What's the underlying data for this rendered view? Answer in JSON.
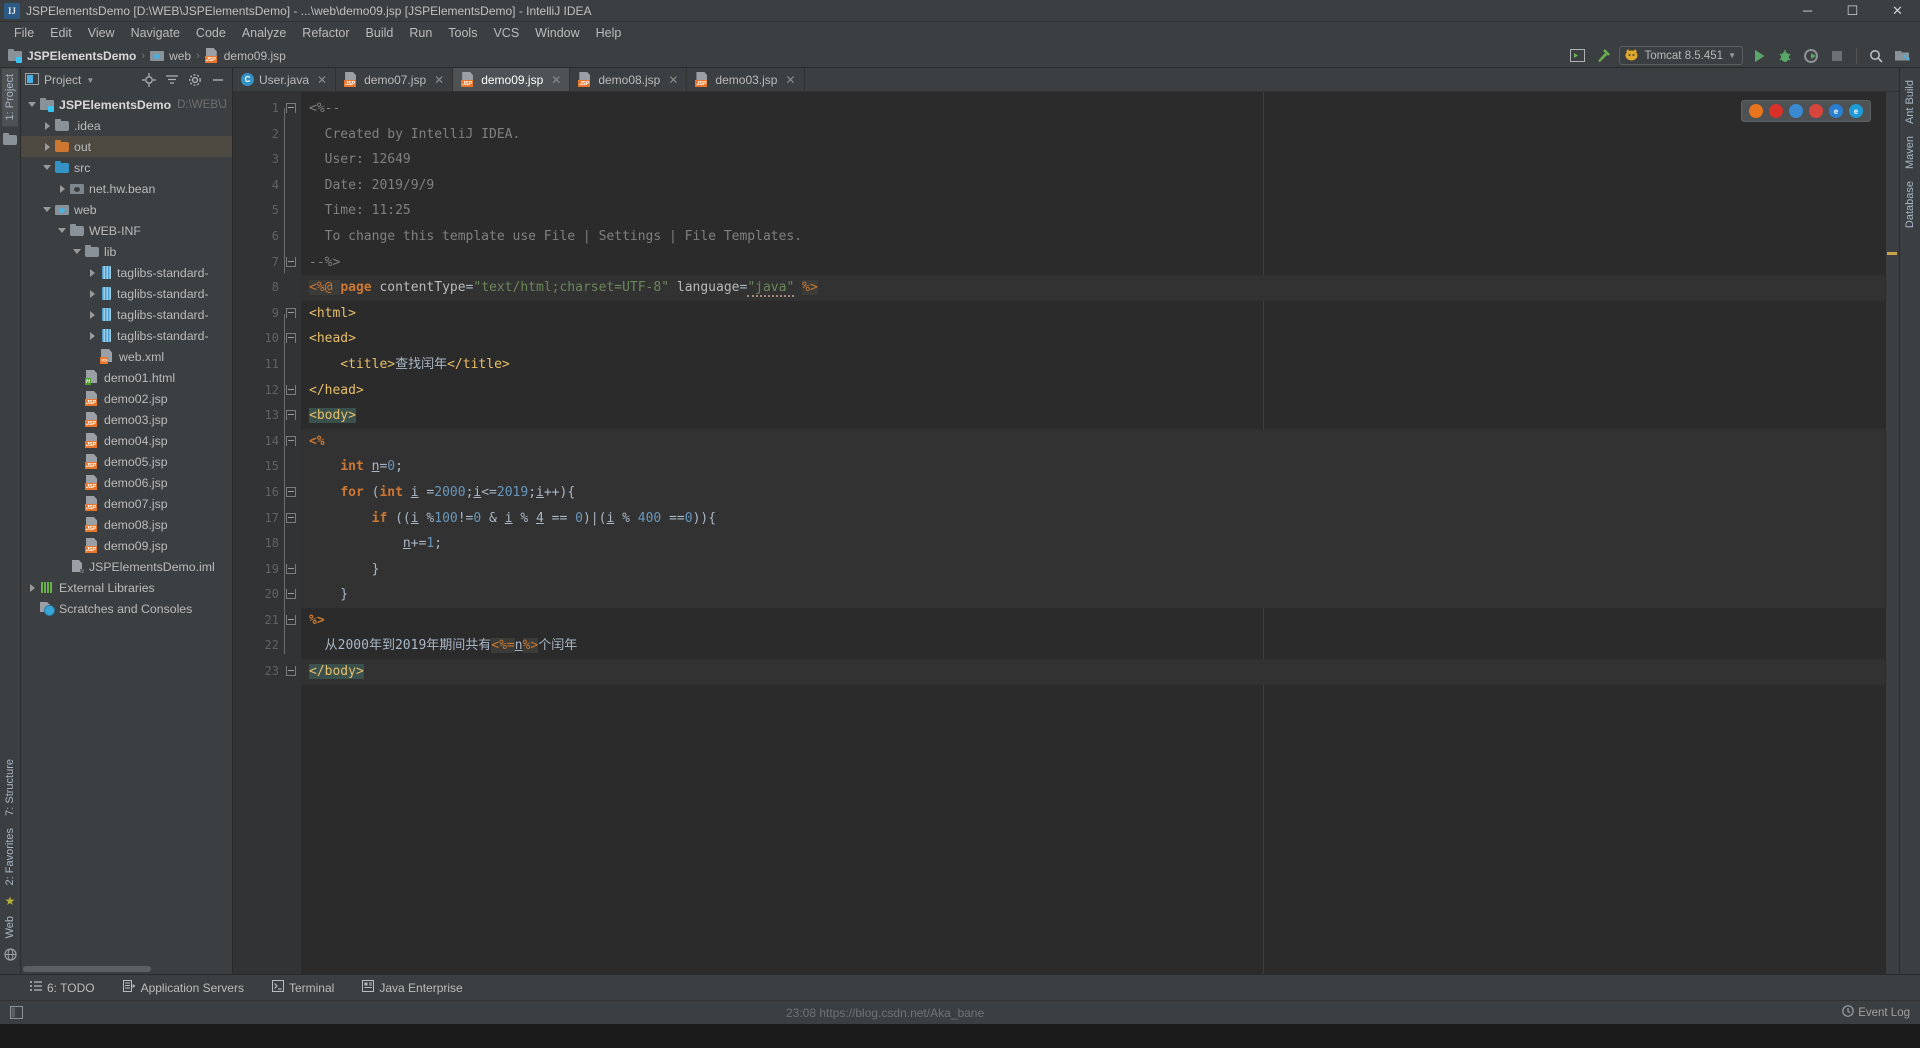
{
  "window": {
    "title": "JSPElementsDemo [D:\\WEB\\JSPElementsDemo] - ...\\web\\demo09.jsp [JSPElementsDemo] - IntelliJ IDEA",
    "app_badge": "IJ",
    "minimize": "─",
    "maximize": "☐",
    "close": "✕"
  },
  "menubar": {
    "items": [
      {
        "label": "File"
      },
      {
        "label": "Edit"
      },
      {
        "label": "View"
      },
      {
        "label": "Navigate"
      },
      {
        "label": "Code"
      },
      {
        "label": "Analyze"
      },
      {
        "label": "Refactor"
      },
      {
        "label": "Build"
      },
      {
        "label": "Run"
      },
      {
        "label": "Tools"
      },
      {
        "label": "VCS"
      },
      {
        "label": "Window"
      },
      {
        "label": "Help"
      }
    ]
  },
  "navbar": {
    "crumbs": [
      {
        "label": "JSPElementsDemo",
        "icon": "module-icon"
      },
      {
        "label": "web",
        "icon": "web-folder-icon"
      },
      {
        "label": "demo09.jsp",
        "icon": "jsp-file-icon"
      }
    ],
    "separator": "›",
    "run_config": {
      "label": "Tomcat 8.5.451",
      "icon": "tomcat-icon",
      "dropdown": "▼"
    },
    "buttons": [
      {
        "name": "restore-layout-icon"
      },
      {
        "name": "build-hammer-icon"
      },
      {
        "name": "run-icon"
      },
      {
        "name": "debug-icon"
      },
      {
        "name": "run-coverage-icon"
      },
      {
        "name": "stop-icon"
      },
      {
        "name": "search-everywhere-icon"
      },
      {
        "name": "project-structure-icon"
      }
    ]
  },
  "left_strip": {
    "top_tab": "1: Project",
    "bottom_tabs": [
      "7: Structure",
      "2: Favorites",
      "Web"
    ]
  },
  "right_strip": {
    "tabs": [
      "Ant Build",
      "Maven",
      "Database"
    ]
  },
  "project_panel": {
    "title": "Project",
    "dropdown": "▼",
    "icons": [
      "locate-icon",
      "collapse-all-icon",
      "settings-gear-icon",
      "hide-icon"
    ],
    "tree": [
      {
        "label": "JSPElementsDemo",
        "sub": "D:\\WEB\\J",
        "depth": 0,
        "arrow": "down",
        "icon": "module-icon",
        "bold": true,
        "selected": false
      },
      {
        "label": ".idea",
        "sub": "",
        "depth": 1,
        "arrow": "right",
        "icon": "folder-icon",
        "bold": false,
        "selected": false
      },
      {
        "label": "out",
        "sub": "",
        "depth": 1,
        "arrow": "right",
        "icon": "folder-orange-icon",
        "bold": false,
        "selected": true
      },
      {
        "label": "src",
        "sub": "",
        "depth": 1,
        "arrow": "down",
        "icon": "folder-blue-icon",
        "bold": false,
        "selected": false
      },
      {
        "label": "net.hw.bean",
        "sub": "",
        "depth": 2,
        "arrow": "right",
        "icon": "package-icon",
        "bold": false,
        "selected": false
      },
      {
        "label": "web",
        "sub": "",
        "depth": 1,
        "arrow": "down",
        "icon": "web-folder-icon",
        "bold": false,
        "selected": false
      },
      {
        "label": "WEB-INF",
        "sub": "",
        "depth": 2,
        "arrow": "down",
        "icon": "folder-icon",
        "bold": false,
        "selected": false
      },
      {
        "label": "lib",
        "sub": "",
        "depth": 3,
        "arrow": "down",
        "icon": "folder-icon",
        "bold": false,
        "selected": false
      },
      {
        "label": "taglibs-standard-",
        "sub": "",
        "depth": 4,
        "arrow": "right",
        "icon": "jar-icon",
        "bold": false,
        "selected": false
      },
      {
        "label": "taglibs-standard-",
        "sub": "",
        "depth": 4,
        "arrow": "right",
        "icon": "jar-icon",
        "bold": false,
        "selected": false
      },
      {
        "label": "taglibs-standard-",
        "sub": "",
        "depth": 4,
        "arrow": "right",
        "icon": "jar-icon",
        "bold": false,
        "selected": false
      },
      {
        "label": "taglibs-standard-",
        "sub": "",
        "depth": 4,
        "arrow": "right",
        "icon": "jar-icon",
        "bold": false,
        "selected": false
      },
      {
        "label": "web.xml",
        "sub": "",
        "depth": 4,
        "arrow": "none",
        "icon": "xml-file-icon",
        "bold": false,
        "selected": false
      },
      {
        "label": "demo01.html",
        "sub": "",
        "depth": 3,
        "arrow": "none",
        "icon": "html-file-icon",
        "bold": false,
        "selected": false
      },
      {
        "label": "demo02.jsp",
        "sub": "",
        "depth": 3,
        "arrow": "none",
        "icon": "jsp-file-icon",
        "bold": false,
        "selected": false
      },
      {
        "label": "demo03.jsp",
        "sub": "",
        "depth": 3,
        "arrow": "none",
        "icon": "jsp-file-icon",
        "bold": false,
        "selected": false
      },
      {
        "label": "demo04.jsp",
        "sub": "",
        "depth": 3,
        "arrow": "none",
        "icon": "jsp-file-icon",
        "bold": false,
        "selected": false
      },
      {
        "label": "demo05.jsp",
        "sub": "",
        "depth": 3,
        "arrow": "none",
        "icon": "jsp-file-icon",
        "bold": false,
        "selected": false
      },
      {
        "label": "demo06.jsp",
        "sub": "",
        "depth": 3,
        "arrow": "none",
        "icon": "jsp-file-icon",
        "bold": false,
        "selected": false
      },
      {
        "label": "demo07.jsp",
        "sub": "",
        "depth": 3,
        "arrow": "none",
        "icon": "jsp-file-icon",
        "bold": false,
        "selected": false
      },
      {
        "label": "demo08.jsp",
        "sub": "",
        "depth": 3,
        "arrow": "none",
        "icon": "jsp-file-icon",
        "bold": false,
        "selected": false
      },
      {
        "label": "demo09.jsp",
        "sub": "",
        "depth": 3,
        "arrow": "none",
        "icon": "jsp-file-icon",
        "bold": false,
        "selected": false
      },
      {
        "label": "JSPElementsDemo.iml",
        "sub": "",
        "depth": 2,
        "arrow": "none",
        "icon": "iml-file-icon",
        "bold": false,
        "selected": false
      },
      {
        "label": "External Libraries",
        "sub": "",
        "depth": 0,
        "arrow": "right",
        "icon": "external-libraries-icon",
        "bold": false,
        "selected": false
      },
      {
        "label": "Scratches and Consoles",
        "sub": "",
        "depth": 0,
        "arrow": "none",
        "icon": "scratches-icon",
        "bold": false,
        "selected": false
      }
    ]
  },
  "editor": {
    "tabs": [
      {
        "label": "User.java",
        "icon": "java-class-icon",
        "active": false,
        "close": "✕"
      },
      {
        "label": "demo07.jsp",
        "icon": "jsp-file-icon",
        "active": false,
        "close": "✕"
      },
      {
        "label": "demo09.jsp",
        "icon": "jsp-file-icon",
        "active": true,
        "close": "✕"
      },
      {
        "label": "demo08.jsp",
        "icon": "jsp-file-icon",
        "active": false,
        "close": "✕"
      },
      {
        "label": "demo03.jsp",
        "icon": "jsp-file-icon",
        "active": false,
        "close": "✕"
      }
    ],
    "browser_popup": [
      {
        "name": "firefox-icon",
        "color": "#e8741e",
        "letter": ""
      },
      {
        "name": "opera-icon",
        "color": "#d8322a",
        "letter": ""
      },
      {
        "name": "chrome-icon",
        "color": "#3a8ad0",
        "letter": ""
      },
      {
        "name": "safari-icon",
        "color": "#d8453c",
        "letter": ""
      },
      {
        "name": "edge-icon",
        "color": "#2a7fd0",
        "letter": "e"
      },
      {
        "name": "ie-icon",
        "color": "#1e9ad6",
        "letter": "e"
      }
    ],
    "line_numbers": [
      1,
      2,
      3,
      4,
      5,
      6,
      7,
      8,
      9,
      10,
      11,
      12,
      13,
      14,
      15,
      16,
      17,
      18,
      19,
      20,
      21,
      22,
      23
    ],
    "code_lines": [
      {
        "n": 1,
        "html": "<span class=\"c-cmt\">&lt;%--</span>",
        "hl": false,
        "fold": "down"
      },
      {
        "n": 2,
        "html": "<span class=\"c-cmt\">  Created by IntelliJ IDEA.</span>",
        "hl": false,
        "fold": "none"
      },
      {
        "n": 3,
        "html": "<span class=\"c-cmt\">  User: 12649</span>",
        "hl": false,
        "fold": "none"
      },
      {
        "n": 4,
        "html": "<span class=\"c-cmt\">  Date: 2019/9/9</span>",
        "hl": false,
        "fold": "none"
      },
      {
        "n": 5,
        "html": "<span class=\"c-cmt\">  Time: 11:25</span>",
        "hl": false,
        "fold": "none"
      },
      {
        "n": 6,
        "html": "<span class=\"c-cmt\">  To change this template use File | Settings | File Templates.</span>",
        "hl": false,
        "fold": "none"
      },
      {
        "n": 7,
        "html": "<span class=\"c-cmt\">--%&gt;</span>",
        "hl": false,
        "fold": "up"
      },
      {
        "n": 8,
        "html": "<span class=\"c-jsp\">&lt;%@ </span><span class=\"c-kw\">page </span><span class=\"c-attr\">contentType</span><span class=\"c-txt\">=</span><span class=\"c-str\">\"text/html;charset=UTF-8\"</span><span class=\"c-txt\"> </span><span class=\"c-attr\">language</span><span class=\"c-txt\">=</span><span class=\"c-warn\">\"java\"</span><span class=\"c-txt\"> </span><span class=\"c-jsp\">%&gt;</span>",
        "hl": true,
        "fold": "none"
      },
      {
        "n": 9,
        "html": "<span class=\"c-tag\">&lt;html&gt;</span>",
        "hl": false,
        "fold": "down"
      },
      {
        "n": 10,
        "html": "<span class=\"c-tag\">&lt;head&gt;</span>",
        "hl": false,
        "fold": "down"
      },
      {
        "n": 11,
        "html": "<span class=\"c-tag\">    &lt;title&gt;</span><span class=\"c-txt\">查找闰年</span><span class=\"c-tag\">&lt;/title&gt;</span>",
        "hl": false,
        "fold": "none"
      },
      {
        "n": 12,
        "html": "<span class=\"c-tag\">&lt;/head&gt;</span>",
        "hl": false,
        "fold": "up"
      },
      {
        "n": 13,
        "html": "<span class=\"sel-tag\">&lt;body&gt;</span>",
        "hl": false,
        "fold": "down"
      },
      {
        "n": 14,
        "html": "<span class=\"c-kw\">&lt;%</span>",
        "hl": true,
        "fold": "down"
      },
      {
        "n": 15,
        "html": "<span class=\"c-txt\">    </span><span class=\"c-kw\">int</span><span class=\"c-txt\"> </span><span class=\"c-field\">n</span><span class=\"c-txt\">=</span><span class=\"c-num\">0</span><span class=\"c-txt\">;</span>",
        "hl": true,
        "fold": "none"
      },
      {
        "n": 16,
        "html": "<span class=\"c-txt\">    </span><span class=\"c-kw\">for</span><span class=\"c-txt\"> (</span><span class=\"c-kw\">int</span><span class=\"c-txt\"> </span><span class=\"c-field\">i</span><span class=\"c-txt\"> =</span><span class=\"c-num\">2000</span><span class=\"c-txt\">;</span><span class=\"c-field\">i</span><span class=\"c-txt\">&lt;=</span><span class=\"c-num\">2019</span><span class=\"c-txt\">;</span><span class=\"c-field\">i</span><span class=\"c-txt\">++){</span>",
        "hl": true,
        "fold": "minus"
      },
      {
        "n": 17,
        "html": "<span class=\"c-txt\">        </span><span class=\"c-kw\">if</span><span class=\"c-txt\"> ((</span><span class=\"c-field\">i</span><span class=\"c-txt\"> %</span><span class=\"c-num\">100</span><span class=\"c-txt\">!=</span><span class=\"c-num\">0</span><span class=\"c-txt\"> &amp; </span><span class=\"c-field\">i</span><span class=\"c-txt\"> % </span><span class=\"c-field\">4</span><span class=\"c-txt\"> == </span><span class=\"c-num\">0</span><span class=\"c-txt\">)|(</span><span class=\"c-field\">i</span><span class=\"c-txt\"> % </span><span class=\"c-num\">400</span><span class=\"c-txt\"> ==</span><span class=\"c-num\">0</span><span class=\"c-txt\">)){</span>",
        "hl": true,
        "fold": "minus"
      },
      {
        "n": 18,
        "html": "<span class=\"c-txt\">            </span><span class=\"c-field\">n</span><span class=\"c-txt\">+=</span><span class=\"c-num\">1</span><span class=\"c-txt\">;</span>",
        "hl": true,
        "fold": "none"
      },
      {
        "n": 19,
        "html": "<span class=\"c-txt\">        }</span>",
        "hl": true,
        "fold": "up"
      },
      {
        "n": 20,
        "html": "<span class=\"c-txt\">    }</span>",
        "hl": true,
        "fold": "up"
      },
      {
        "n": 21,
        "html": "<span class=\"c-kw\">%&gt;</span>",
        "hl": false,
        "fold": "up"
      },
      {
        "n": 22,
        "html": "<span class=\"c-txt\">  从2000年到2019年期间共有</span><span class=\"c-jsp\">&lt;%=</span><span class=\"c-field\">n</span><span class=\"c-jsp\">%&gt;</span><span class=\"c-txt\">个闰年</span>",
        "hl": false,
        "fold": "none"
      },
      {
        "n": 23,
        "html": "<span class=\"sel-tag\">&lt;/body&gt;</span>",
        "hl": true,
        "fold": "up"
      }
    ]
  },
  "bottom_bar": {
    "items": [
      {
        "label": "6: TODO",
        "icon": "todo-list-icon"
      },
      {
        "label": "Application Servers",
        "icon": "app-servers-icon"
      },
      {
        "label": "Terminal",
        "icon": "terminal-icon"
      },
      {
        "label": "Java Enterprise",
        "icon": "java-enterprise-icon"
      }
    ]
  },
  "status_bar": {
    "left_icon": "show-tool-windows-icon",
    "event_log": "Event Log",
    "event_log_icon": "event-log-icon",
    "watermark": "23:08 https://blog.csdn.net/Aka_bane"
  }
}
